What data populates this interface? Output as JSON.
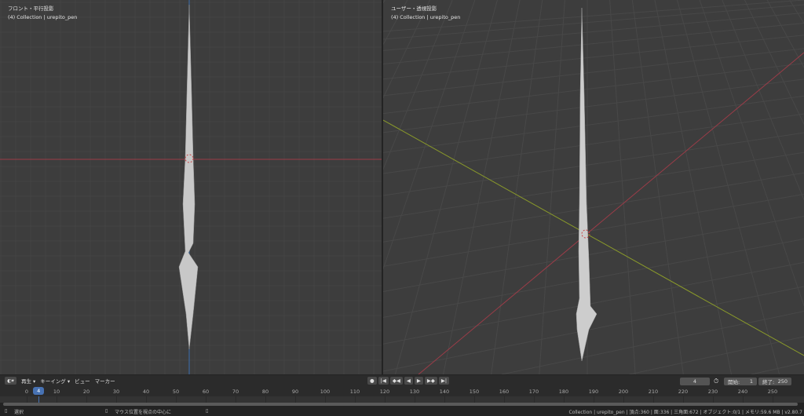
{
  "viewports": {
    "left": {
      "view_name": "フロント・平行投影",
      "collection": "(4) Collection | urepito_pen"
    },
    "right": {
      "view_name": "ユーザー・透視投影",
      "collection": "(4) Collection | urepito_pen"
    }
  },
  "timeline": {
    "menus": [
      "再生",
      "キーイング",
      "ビュー",
      "マーカー"
    ],
    "current_frame": "4",
    "start_label": "開始:",
    "start": "1",
    "end_label": "終了:",
    "end": "250",
    "ticks": [
      0,
      10,
      20,
      30,
      40,
      50,
      60,
      70,
      80,
      90,
      100,
      110,
      120,
      130,
      140,
      150,
      160,
      170,
      180,
      190,
      200,
      210,
      220,
      230,
      240,
      250
    ]
  },
  "status": {
    "select": "選択",
    "center_view": "マウス位置を視点の中心に",
    "info": "Collection | urepito_pen | 頂点:360 | 面:336 | 三角面:672 | オブジェクト:0/1 | メモリ:59.6 MB | v2.80.7"
  },
  "colors": {
    "x_axis": "#9b3c48",
    "y_axis": "#8a9a2a",
    "z_axis": "#3a6db0",
    "accent": "#4772b3"
  }
}
